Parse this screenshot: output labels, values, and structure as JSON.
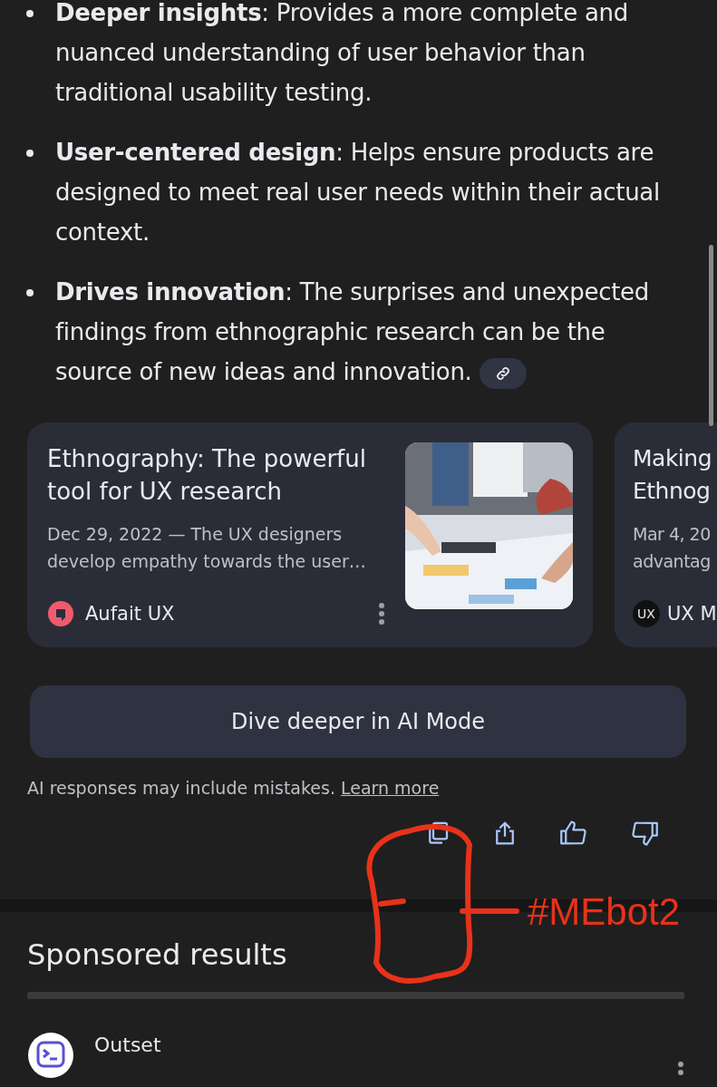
{
  "bullets": [
    {
      "text": "**Deeper insights**: Provides a more complete and nuanced understanding of user behavior than traditional usability testing.",
      "link_chip": false
    },
    {
      "text": "**User-centered design**: Helps ensure products are designed to meet real user needs within their actual context.",
      "link_chip": false
    },
    {
      "text": "**Drives innovation**: The surprises and unexpected findings from ethnographic research can be the source of new ideas and innovation.",
      "link_chip": true
    }
  ],
  "cards": [
    {
      "title": "Ethnography: The powerful tool for UX research",
      "snippet": "Dec 29, 2022 — The UX designers develop empathy towards the user…",
      "source": "Aufait UX",
      "has_image": true
    },
    {
      "title": "Making Ethnog",
      "snippet": "Mar 4, 20 advantag",
      "source": "UX M",
      "source_logo_text": "UX",
      "has_image": false
    }
  ],
  "dive_button": "Dive deeper in AI Mode",
  "disclaimer": {
    "text": "AI responses may include mistakes.",
    "link": "Learn more"
  },
  "feedback_actions": [
    {
      "kind": "copy"
    },
    {
      "kind": "share"
    },
    {
      "kind": "thumbs_up"
    },
    {
      "kind": "thumbs_down"
    }
  ],
  "annotation": {
    "text": "#MEbot2"
  },
  "sponsored": {
    "heading": "Sponsored results",
    "results": [
      {
        "name": "Outset"
      }
    ]
  }
}
